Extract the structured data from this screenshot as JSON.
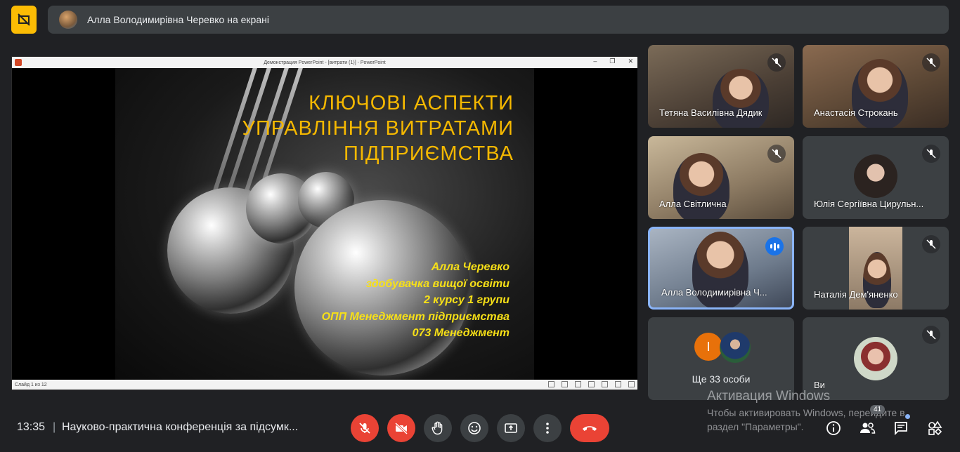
{
  "banner": {
    "text": "Алла Володимирівна Черевко на екрані"
  },
  "powerpoint": {
    "window_title": "Демонстрация PowerPoint - [витрати (1)] - PowerPoint",
    "status": "Слайд 1 из 12"
  },
  "slide": {
    "title_lines": [
      "КЛЮЧОВІ АСПЕКТИ",
      "УПРАВЛІННЯ ВИТРАТАМИ",
      "ПІДПРИЄМСТВА"
    ],
    "subtitle_lines": [
      "Алла Черевко",
      "здобувачка вищої освіти",
      "2 курсу 1 групи",
      "ОПП Менеджмент підприємства",
      "073 Менеджмент"
    ]
  },
  "participants": [
    {
      "name": "Тетяна Василівна Дядик",
      "muted": true
    },
    {
      "name": "Анастасія Строкань",
      "muted": true
    },
    {
      "name": "Алла Світлична",
      "muted": true
    },
    {
      "name": "Юлія Сергіївна Цирульн...",
      "muted": true
    },
    {
      "name": "Алла Володимирівна Ч...",
      "speaking": true
    },
    {
      "name": "Наталія Дем'яненко",
      "muted": true
    },
    {
      "name": "Ви",
      "muted": true
    }
  ],
  "more_people": {
    "initial": "І",
    "label": "Ще 33 особи"
  },
  "bottom_bar": {
    "time": "13:35",
    "separator": "|",
    "meeting_title": "Науково-практична конференція за підсумк...",
    "participant_count": "41"
  },
  "watermark": {
    "line1": "Активация Windows",
    "line2": "Чтобы активировать Windows, перейдите в раздел \"Параметры\"."
  },
  "colors": {
    "speaking_border": "#8ab4f8",
    "present_button": "#fbbc04",
    "end_call": "#ea4335"
  }
}
